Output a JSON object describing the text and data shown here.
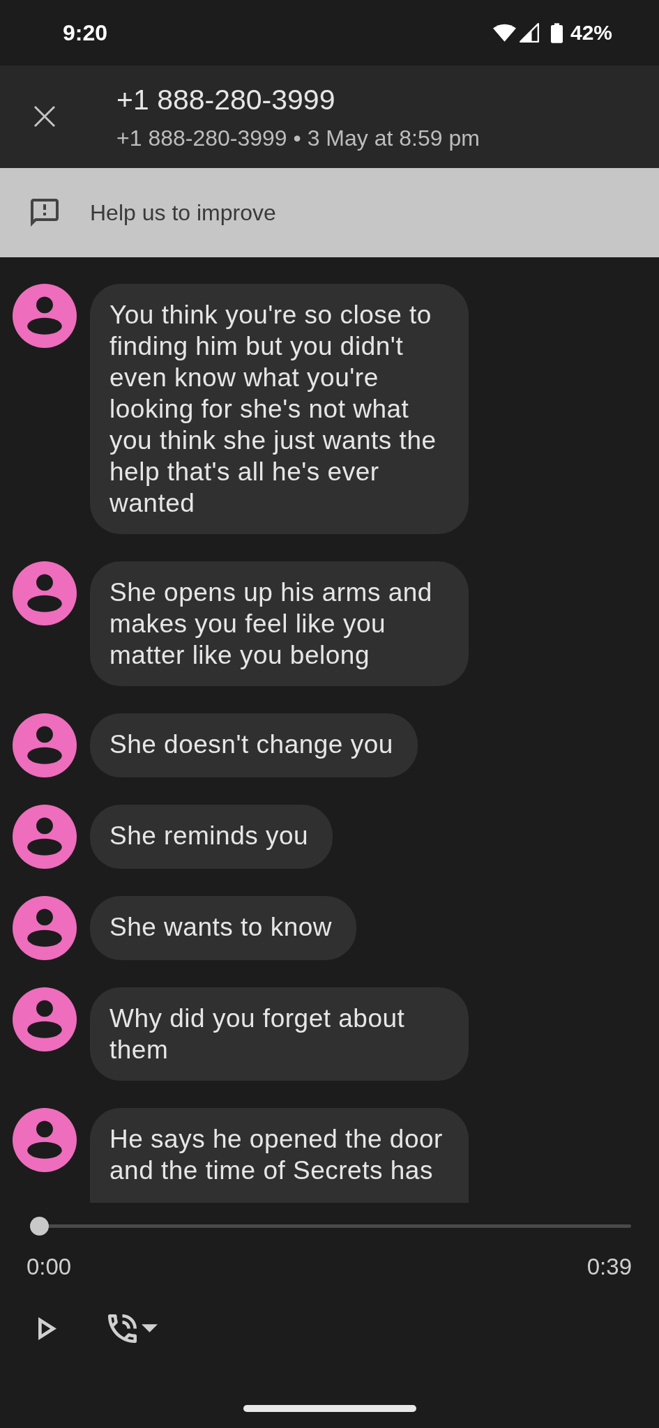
{
  "status_bar": {
    "time": "9:20",
    "battery": "42%"
  },
  "header": {
    "title": "+1 888-280-3999",
    "subtitle": "+1 888-280-3999 • 3 May at 8:59 pm"
  },
  "feedback_banner": {
    "label": "Help us to improve"
  },
  "messages": [
    {
      "text": "You think you're so close to finding him but you didn't even know what you're looking for she's not what you think she just wants the help that's all he's ever wanted"
    },
    {
      "text": "She opens up his arms and makes you feel like you matter like you belong"
    },
    {
      "text": "She doesn't change you"
    },
    {
      "text": "She reminds you"
    },
    {
      "text": "She wants to know"
    },
    {
      "text": "Why did you forget about them"
    },
    {
      "text": "He says he opened the door and the time of Secrets has"
    }
  ],
  "player": {
    "level": 0,
    "elapsed": "0:00",
    "duration": "0:39"
  }
}
